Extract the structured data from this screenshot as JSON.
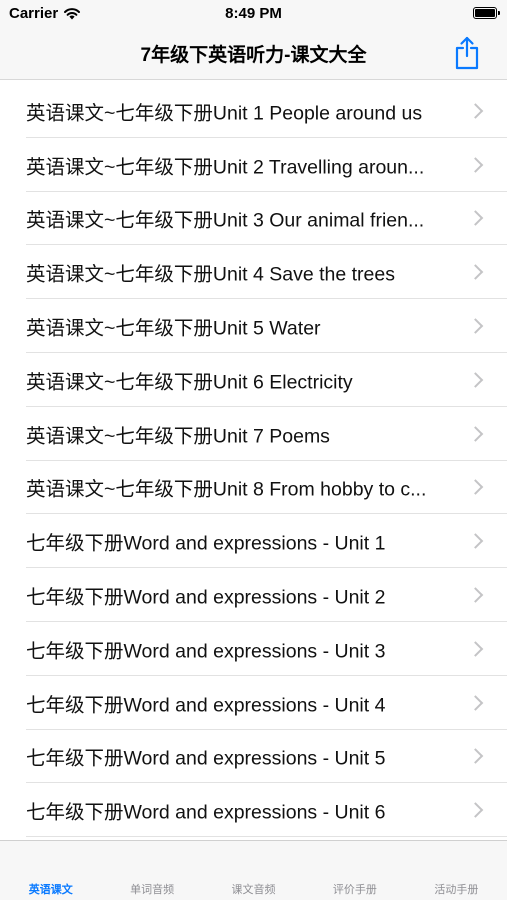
{
  "status": {
    "carrier": "Carrier",
    "time": "8:49 PM"
  },
  "nav": {
    "title": "7年级下英语听力-课文大全"
  },
  "items": [
    {
      "label": "英语课文~七年级下册Unit 1 People around us"
    },
    {
      "label": "英语课文~七年级下册Unit 2 Travelling aroun..."
    },
    {
      "label": "英语课文~七年级下册Unit 3 Our animal frien..."
    },
    {
      "label": "英语课文~七年级下册Unit 4 Save the trees"
    },
    {
      "label": "英语课文~七年级下册Unit 5 Water"
    },
    {
      "label": "英语课文~七年级下册Unit 6 Electricity"
    },
    {
      "label": "英语课文~七年级下册Unit 7 Poems"
    },
    {
      "label": "英语课文~七年级下册Unit 8 From hobby to c..."
    },
    {
      "label": "七年级下册Word and expressions - Unit 1"
    },
    {
      "label": "七年级下册Word and expressions - Unit 2"
    },
    {
      "label": "七年级下册Word and expressions - Unit 3"
    },
    {
      "label": "七年级下册Word and expressions - Unit 4"
    },
    {
      "label": "七年级下册Word and expressions - Unit 5"
    },
    {
      "label": "七年级下册Word and expressions - Unit 6"
    }
  ],
  "tabs": [
    {
      "label": "英语课文",
      "active": true
    },
    {
      "label": "单词音频",
      "active": false
    },
    {
      "label": "课文音频",
      "active": false
    },
    {
      "label": "评价手册",
      "active": false
    },
    {
      "label": "活动手册",
      "active": false
    }
  ],
  "colors": {
    "accent": "#0a7aff",
    "chevron": "#c4c4c6",
    "bar_background": "#f7f7f7"
  },
  "icons": {
    "share": "share-icon",
    "wifi": "wifi-icon",
    "battery": "battery-icon",
    "disclosure": "chevron-right-icon"
  }
}
